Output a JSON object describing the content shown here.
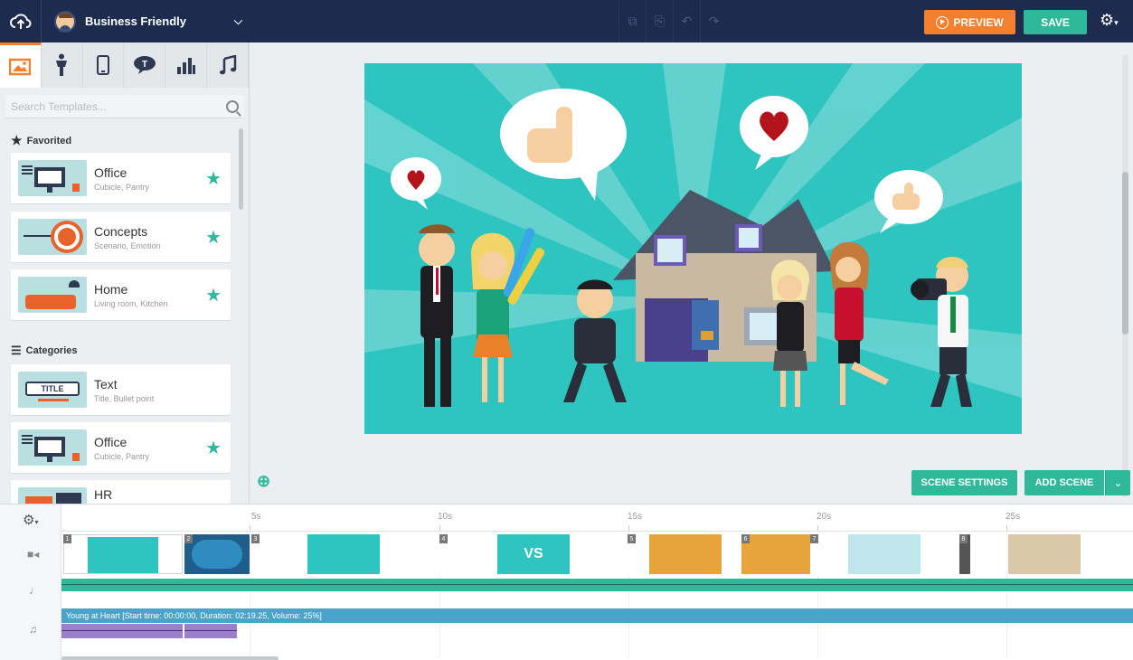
{
  "topbar": {
    "theme_name": "Business Friendly",
    "preview_label": "PREVIEW",
    "save_label": "SAVE"
  },
  "sidebar": {
    "search_placeholder": "Search Templates...",
    "favorited_heading": "Favorited",
    "categories_heading": "Categories",
    "favorites": [
      {
        "title": "Office",
        "subtitle": "Cubicle, Pantry"
      },
      {
        "title": "Concepts",
        "subtitle": "Scenario, Emotion"
      },
      {
        "title": "Home",
        "subtitle": "Living room, Kitchen"
      }
    ],
    "categories": [
      {
        "title": "Text",
        "subtitle": "Title, Bullet point",
        "thumb_text": "TITLE"
      },
      {
        "title": "Office",
        "subtitle": "Cubicle, Pantry"
      },
      {
        "title": "HR",
        "subtitle": ""
      }
    ]
  },
  "stage": {
    "scene_settings_label": "SCENE SETTINGS",
    "add_scene_label": "ADD SCENE",
    "background_color": "#2ec4c0"
  },
  "timeline": {
    "ticks": [
      "5s",
      "10s",
      "15s",
      "20s",
      "25s"
    ],
    "scene_numbers": [
      "1",
      "2",
      "3",
      "4",
      "5",
      "6",
      "7",
      "8"
    ],
    "scene4_text": "VS",
    "music_label": "Young at Heart [Start time: 00:00:00, Duration: 02:19.25, Volume: 25%]"
  },
  "colors": {
    "topbar": "#1d2b4e",
    "accent_orange": "#f47f2c",
    "accent_green": "#2fb99a",
    "music_blue": "#4aa3c8",
    "music_purple": "#9b7fc8"
  }
}
